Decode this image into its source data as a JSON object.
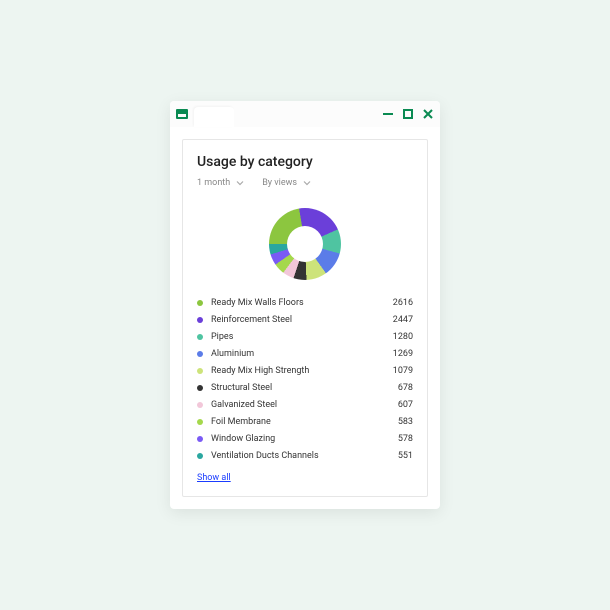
{
  "card": {
    "title": "Usage by category",
    "filters": {
      "time": "1 month",
      "sort": "By views"
    },
    "show_all_label": "Show all"
  },
  "legend": [
    {
      "label": "Ready Mix Walls Floors",
      "value": 2616,
      "color": "#8cc63f"
    },
    {
      "label": "Reinforcement Steel",
      "value": 2447,
      "color": "#6b3fd9"
    },
    {
      "label": "Pipes",
      "value": 1280,
      "color": "#4fc4a1"
    },
    {
      "label": "Aluminium",
      "value": 1269,
      "color": "#5b7ce8"
    },
    {
      "label": "Ready Mix High Strength",
      "value": 1079,
      "color": "#cde37a"
    },
    {
      "label": "Structural Steel",
      "value": 678,
      "color": "#333333"
    },
    {
      "label": "Galvanized Steel",
      "value": 607,
      "color": "#f2c7d9"
    },
    {
      "label": "Foil Membrane",
      "value": 583,
      "color": "#a5d84c"
    },
    {
      "label": "Window Glazing",
      "value": 578,
      "color": "#7a5af5"
    },
    {
      "label": "Ventilation Ducts Channels",
      "value": 551,
      "color": "#2aa7a0"
    }
  ],
  "chart_data": {
    "type": "pie",
    "title": "Usage by category",
    "series": [
      {
        "name": "Ready Mix Walls Floors",
        "value": 2616,
        "color": "#8cc63f"
      },
      {
        "name": "Reinforcement Steel",
        "value": 2447,
        "color": "#6b3fd9"
      },
      {
        "name": "Pipes",
        "value": 1280,
        "color": "#4fc4a1"
      },
      {
        "name": "Aluminium",
        "value": 1269,
        "color": "#5b7ce8"
      },
      {
        "name": "Ready Mix High Strength",
        "value": 1079,
        "color": "#cde37a"
      },
      {
        "name": "Structural Steel",
        "value": 678,
        "color": "#333333"
      },
      {
        "name": "Galvanized Steel",
        "value": 607,
        "color": "#f2c7d9"
      },
      {
        "name": "Foil Membrane",
        "value": 583,
        "color": "#a5d84c"
      },
      {
        "name": "Window Glazing",
        "value": 578,
        "color": "#7a5af5"
      },
      {
        "name": "Ventilation Ducts Channels",
        "value": 551,
        "color": "#2aa7a0"
      }
    ]
  }
}
